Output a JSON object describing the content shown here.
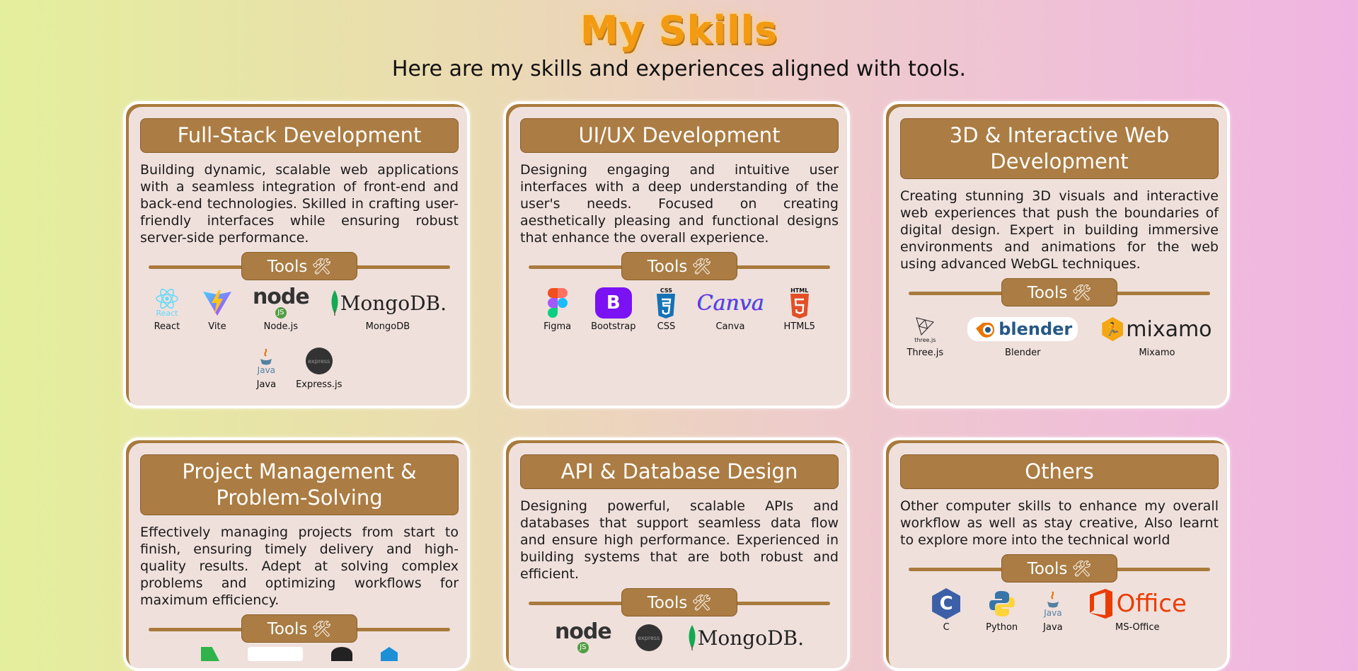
{
  "page": {
    "title": "My Skills",
    "subtitle": "Here are my skills and experiences aligned with tools.",
    "tools_label": "Tools"
  },
  "cards": [
    {
      "title": "Full-Stack Development",
      "description": "Building dynamic, scalable web applications with a seamless integration of front-end and back-end technologies. Skilled in crafting user-friendly interfaces while ensuring robust server-side performance.",
      "tools": [
        "React",
        "Vite",
        "Node.js",
        "MongoDB",
        "Java",
        "Express.js"
      ]
    },
    {
      "title": "UI/UX Development",
      "description": "Designing engaging and intuitive user interfaces with a deep understanding of the user's needs. Focused on creating aesthetically pleasing and functional designs that enhance the overall experience.",
      "tools": [
        "Figma",
        "Bootstrap",
        "CSS",
        "Canva",
        "HTML5"
      ]
    },
    {
      "title": "3D & Interactive Web Development",
      "description": "Creating stunning 3D visuals and interactive web experiences that push the boundaries of digital design. Expert in building immersive environments and animations for the web using advanced WebGL techniques.",
      "tools": [
        "Three.js",
        "Blender",
        "Mixamo"
      ]
    },
    {
      "title": "Project Management & Problem-Solving",
      "description": "Effectively managing projects from start to finish, ensuring timely delivery and high-quality results. Adept at solving complex problems and optimizing workflows for maximum efficiency.",
      "tools": []
    },
    {
      "title": "API & Database Design",
      "description": "Designing powerful, scalable APIs and databases that support seamless data flow and ensure high performance. Experienced in building systems that are both robust and efficient.",
      "tools": []
    },
    {
      "title": "Others",
      "description": "Other computer skills to enhance my overall workflow as well as stay creative, Also learnt to explore more into the technical world",
      "tools": [
        "C",
        "Python",
        "Java",
        "MS-Office"
      ]
    }
  ],
  "logos": {
    "react": "React",
    "node": "node",
    "node_js": "JS",
    "mongodb": "MongoDB.",
    "java": "Java",
    "express": "express",
    "bootstrap": "B",
    "css": "CSS",
    "canva": "Canva",
    "html": "HTML",
    "three": "three.js",
    "blender": "blender",
    "mixamo": "mixamo",
    "c": "C",
    "office": "Office"
  },
  "colors": {
    "accent": "#ab7c43",
    "title": "#f39a10",
    "card_bg": "#efe0dc"
  }
}
